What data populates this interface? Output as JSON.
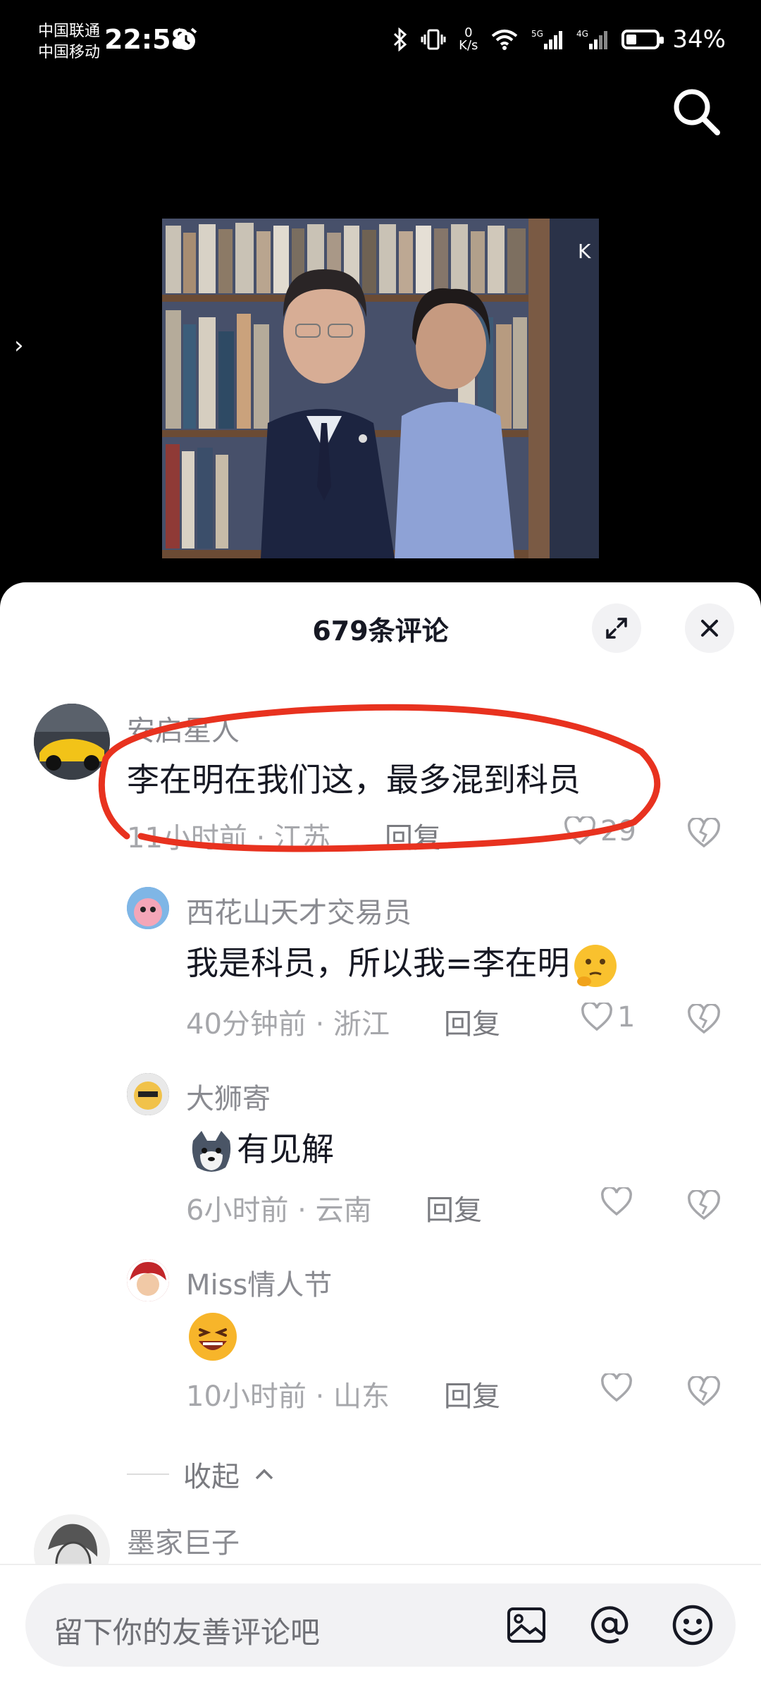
{
  "status_bar": {
    "carrier1": "中国联通",
    "carrier2": "中国移动",
    "time": "22:58",
    "net_speed_value": "0",
    "net_speed_unit": "K/s",
    "battery": "34%",
    "battery_level": 0.34
  },
  "sheet": {
    "title": "679条评论"
  },
  "comments": [
    {
      "username": "安启星人",
      "text": "李在明在我们这，最多混到科员",
      "meta": "11小时前 · 江苏",
      "reply": "回复",
      "likes": "29"
    },
    {
      "username": "西花山天才交易员",
      "text": "我是科员，所以我=李在明",
      "meta": "40分钟前 · 浙江",
      "reply": "回复",
      "likes": "1"
    },
    {
      "username": "大狮寄",
      "text": "有见解",
      "meta": "6小时前 · 云南",
      "reply": "回复",
      "likes": ""
    },
    {
      "username": "Miss情人节",
      "text": "",
      "meta": "10小时前 · 山东",
      "reply": "回复",
      "likes": ""
    },
    {
      "username": "墨家巨子"
    }
  ],
  "collapse_label": "收起",
  "input": {
    "placeholder": "留下你的友善评论吧"
  },
  "video": {
    "watermark": "K"
  },
  "colors": {
    "annotation_red": "#e8321f",
    "sheet_bg": "#ffffff"
  }
}
